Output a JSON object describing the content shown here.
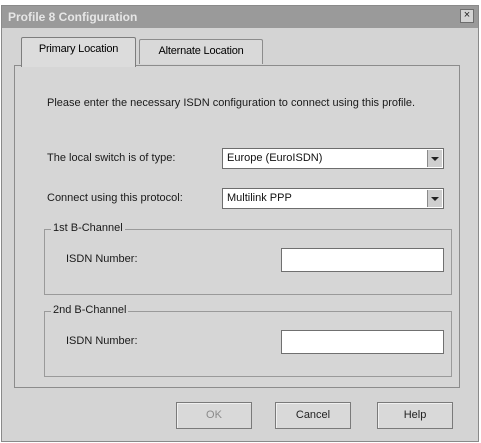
{
  "window": {
    "title": "Profile 8 Configuration",
    "close_glyph": "×"
  },
  "tabs": [
    {
      "label": "Primary Location",
      "active": true
    },
    {
      "label": "Alternate Location",
      "active": false
    }
  ],
  "panel": {
    "instructions": "Please enter the necessary ISDN configuration to connect using this profile.",
    "switch_label": "The local switch is of type:",
    "switch_value": "Europe (EuroISDN)",
    "protocol_label": "Connect using this protocol:",
    "protocol_value": "Multilink PPP",
    "group1": {
      "title": "1st B-Channel",
      "isdn_label": "ISDN Number:",
      "isdn_value": ""
    },
    "group2": {
      "title": "2nd B-Channel",
      "isdn_label": "ISDN Number:",
      "isdn_value": ""
    }
  },
  "buttons": {
    "ok": "OK",
    "cancel": "Cancel",
    "help": "Help"
  }
}
